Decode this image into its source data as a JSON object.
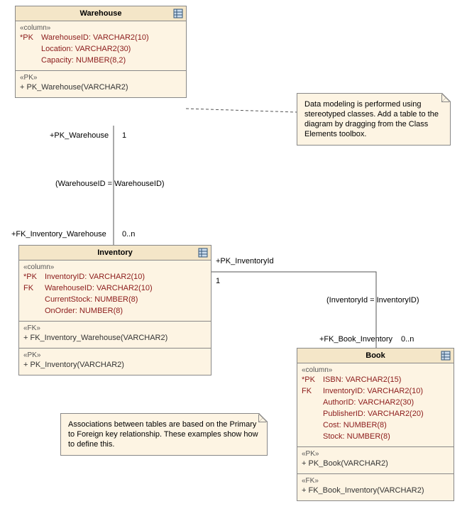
{
  "entities": {
    "warehouse": {
      "title": "Warehouse",
      "col_stereo": "«column»",
      "cols": [
        {
          "pk": "*PK",
          "text": "WarehouseID: VARCHAR2(10)"
        },
        {
          "pk": "",
          "text": "Location: VARCHAR2(30)"
        },
        {
          "pk": "",
          "text": "Capacity: NUMBER(8,2)"
        }
      ],
      "pk_stereo": "«PK»",
      "pk_row": "+    PK_Warehouse(VARCHAR2)"
    },
    "inventory": {
      "title": "Inventory",
      "col_stereo": "«column»",
      "cols": [
        {
          "pk": "*PK",
          "text": "InventoryID: VARCHAR2(10)"
        },
        {
          "pk": "FK",
          "text": "WarehouseID: VARCHAR2(10)"
        },
        {
          "pk": "",
          "text": "CurrentStock: NUMBER(8)"
        },
        {
          "pk": "",
          "text": "OnOrder: NUMBER(8)"
        }
      ],
      "fk_stereo": "«FK»",
      "fk_row": "+    FK_Inventory_Warehouse(VARCHAR2)",
      "pk_stereo": "«PK»",
      "pk_row": "+    PK_Inventory(VARCHAR2)"
    },
    "book": {
      "title": "Book",
      "col_stereo": "«column»",
      "cols": [
        {
          "pk": "*PK",
          "text": "ISBN: VARCHAR2(15)"
        },
        {
          "pk": "FK",
          "text": "InventoryID: VARCHAR2(10)"
        },
        {
          "pk": "",
          "text": "AuthorID: VARCHAR2(30)"
        },
        {
          "pk": "",
          "text": "PublisherID: VARCHAR2(20)"
        },
        {
          "pk": "",
          "text": "Cost: NUMBER(8)"
        },
        {
          "pk": "",
          "text": "Stock: NUMBER(8)"
        }
      ],
      "pk_stereo": "«PK»",
      "pk_row": "+    PK_Book(VARCHAR2)",
      "fk_stereo": "«FK»",
      "fk_row": "+    FK_Book_Inventory(VARCHAR2)"
    }
  },
  "notes": {
    "note1": "Data modeling is performed using stereotyped classes. Add a table to the diagram by dragging from the Class Elements toolbox.",
    "note2": "Associations between tables are based on the Primary to Foreign key relationship. These examples show how to define this."
  },
  "labels": {
    "l1": "+PK_Warehouse",
    "l1m": "1",
    "l2": "(WarehouseID = WarehouseID)",
    "l3": "+FK_Inventory_Warehouse",
    "l3m": "0..n",
    "l4": "+PK_InventoryId",
    "l4m": "1",
    "l5": "(InventoryId = InventoryID)",
    "l6": "+FK_Book_Inventory",
    "l6m": "0..n"
  }
}
